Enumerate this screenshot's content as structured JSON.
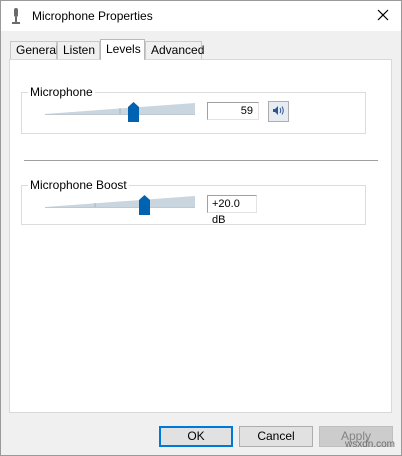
{
  "window": {
    "title": "Microphone Properties",
    "icon": "microphone-icon",
    "close_glyph": "✕"
  },
  "tabs": [
    {
      "label": "General",
      "active": false
    },
    {
      "label": "Listen",
      "active": false
    },
    {
      "label": "Levels",
      "active": true
    },
    {
      "label": "Advanced",
      "active": false
    }
  ],
  "levels": {
    "microphone": {
      "label": "Microphone",
      "value": "59",
      "level_fraction": 0.59,
      "mute_icon": "speaker-icon"
    },
    "boost": {
      "label": "Microphone Boost",
      "value": "+20.0 dB",
      "level_fraction": 0.66
    }
  },
  "buttons": {
    "ok": "OK",
    "cancel": "Cancel",
    "apply": "Apply"
  },
  "watermark": "wsxdn.com",
  "colors": {
    "accent": "#0078d7",
    "track": "#c9d5df",
    "disabled_text": "#838383"
  }
}
